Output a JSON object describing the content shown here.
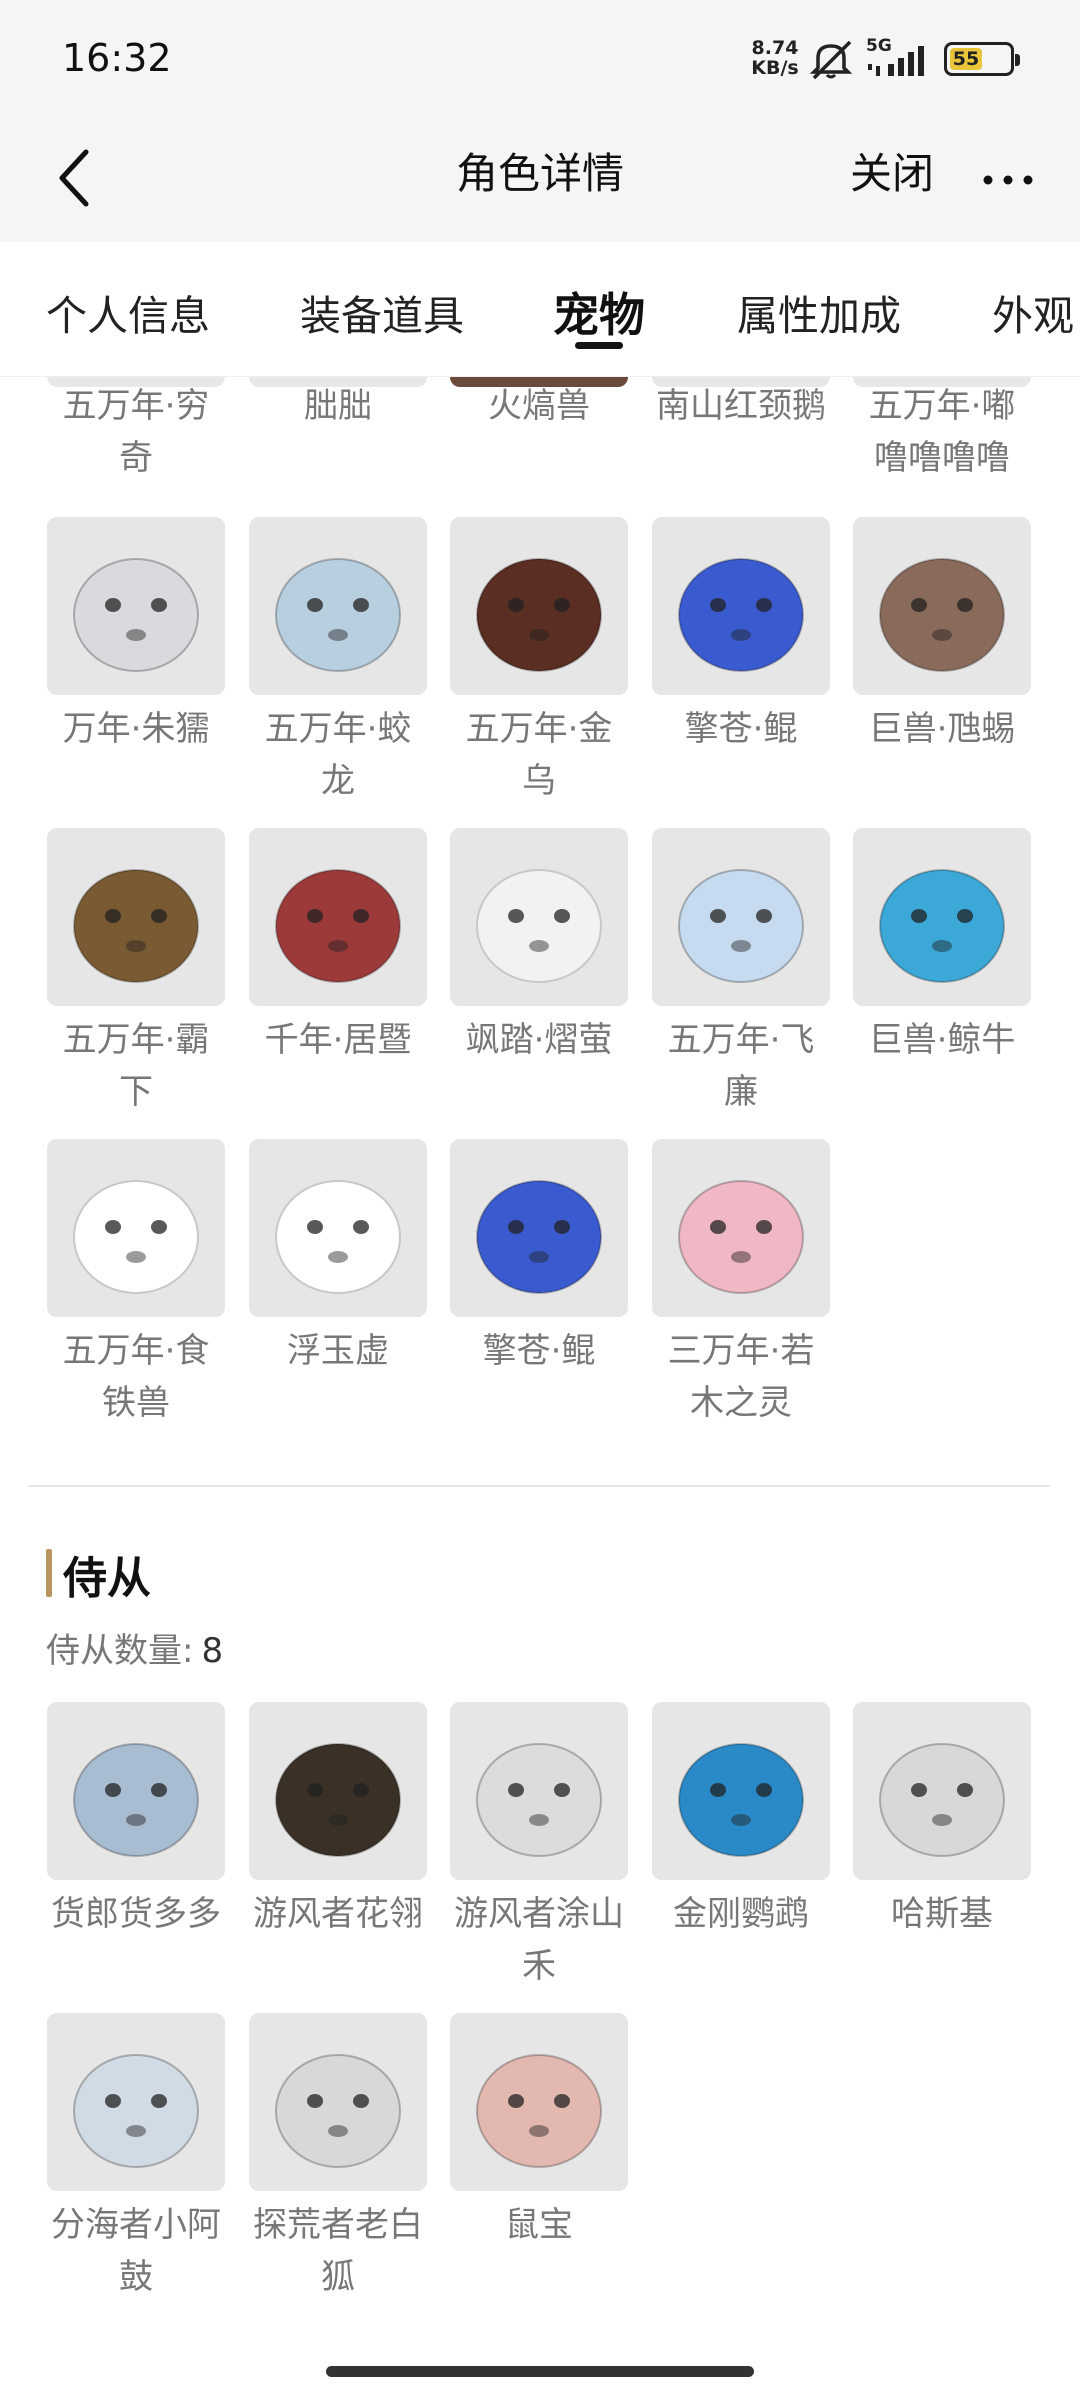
{
  "status_bar": {
    "time": "16:32",
    "network_speed": "8.74",
    "network_unit": "KB/s",
    "signal_label": "5G",
    "battery": "55",
    "battery_fill": 0.55
  },
  "nav": {
    "title": "角色详情",
    "close_label": "关闭"
  },
  "tabs": [
    {
      "label": "个人信息",
      "active": false
    },
    {
      "label": "装备道具",
      "active": false
    },
    {
      "label": "宠物",
      "active": true
    },
    {
      "label": "属性加成",
      "active": false
    },
    {
      "label": "外观",
      "active": false
    }
  ],
  "pets_partial_row": [
    "五万年·穷奇",
    "朏朏",
    "火熇兽",
    "南山红颈鹅",
    "五万年·嘟噜噜噜噜"
  ],
  "pets": [
    {
      "name": "万年·朱獳",
      "icon": "white-fox-icon",
      "color": "#d9d9de"
    },
    {
      "name": "五万年·蛟龙",
      "icon": "ice-dragon-icon",
      "color": "#b8cfe0"
    },
    {
      "name": "五万年·金乌",
      "icon": "fire-dragon-icon",
      "color": "#5a2e22"
    },
    {
      "name": "擎苍·鲲",
      "icon": "blue-whale-icon",
      "color": "#3a5bd0"
    },
    {
      "name": "巨兽·虺蜴",
      "icon": "rock-lizard-icon",
      "color": "#8a6a5a"
    },
    {
      "name": "五万年·霸下",
      "icon": "bronze-dragon-icon",
      "color": "#7a5a32"
    },
    {
      "name": "千年·居暨",
      "icon": "red-squirrel-icon",
      "color": "#9c3a3a"
    },
    {
      "name": "飒踏·熠萤",
      "icon": "white-spirit-icon",
      "color": "#f2f2f2"
    },
    {
      "name": "五万年·飞廉",
      "icon": "ice-bird-icon",
      "color": "#c6dbef"
    },
    {
      "name": "巨兽·鲸牛",
      "icon": "ice-whale-icon",
      "color": "#3ba8d8"
    },
    {
      "name": "五万年·食铁兽",
      "icon": "panda-icon",
      "color": "#ffffff"
    },
    {
      "name": "浮玉虚",
      "icon": "white-cloud-icon",
      "color": "#ffffff"
    },
    {
      "name": "擎苍·鲲",
      "icon": "blue-whale-icon",
      "color": "#3a5bd0"
    },
    {
      "name": "三万年·若木之灵",
      "icon": "lotus-spirit-icon",
      "color": "#f0b8c4"
    }
  ],
  "attendants": {
    "title": "侍从",
    "count_label": "侍从数量:",
    "count": "8",
    "items": [
      {
        "name": "货郎货多多",
        "icon": "blue-lizard-icon",
        "color": "#a8bcd2"
      },
      {
        "name": "游风者花翎",
        "icon": "eagle-icon",
        "color": "#3a3026"
      },
      {
        "name": "游风者涂山禾",
        "icon": "white-wolf-icon",
        "color": "#dcdcdc"
      },
      {
        "name": "金刚鹦鹉",
        "icon": "macaw-icon",
        "color": "#2a8ac8"
      },
      {
        "name": "哈斯基",
        "icon": "husky-icon",
        "color": "#d8d8d8"
      },
      {
        "name": "分海者小阿鼓",
        "icon": "girl-icon",
        "color": "#d0dbe6"
      },
      {
        "name": "探荒者老白狐",
        "icon": "white-fox-face-icon",
        "color": "#d8d8d8"
      },
      {
        "name": "鼠宝",
        "icon": "rat-icon",
        "color": "#e3b8b0"
      }
    ]
  }
}
